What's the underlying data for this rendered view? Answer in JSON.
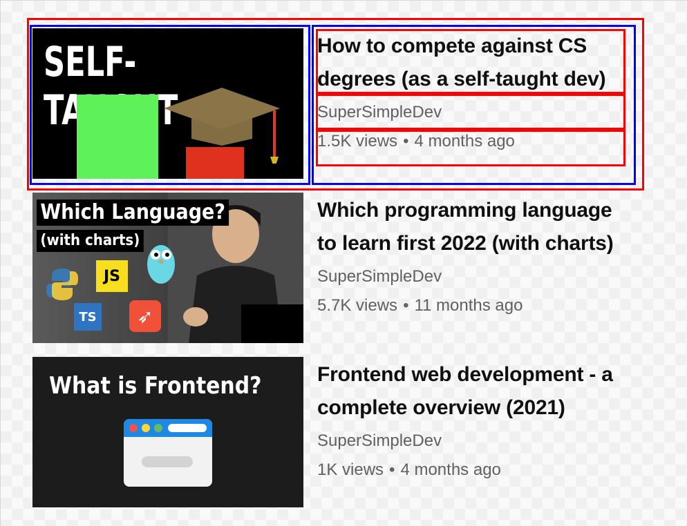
{
  "videos": [
    {
      "title": "How to compete against CS degrees (as a self-taught dev)",
      "channel": "SuperSimpleDev",
      "views": "1.5K views",
      "separator": "•",
      "age": "4 months ago",
      "thumbnail_text": "SELF-TAUGHT"
    },
    {
      "title": "Which programming language to learn first 2022 (with charts)",
      "channel": "SuperSimpleDev",
      "views": "5.7K views",
      "separator": "•",
      "age": "11 months ago",
      "thumbnail_text": "Which Language?",
      "thumbnail_subtext": "(with charts)",
      "thumbnail_logos": {
        "js": "JS",
        "ts": "TS"
      }
    },
    {
      "title": "Frontend web development - a complete overview (2021)",
      "channel": "SuperSimpleDev",
      "views": "1K views",
      "separator": "•",
      "age": "4 months ago",
      "thumbnail_text": "What is Frontend?"
    }
  ],
  "colors": {
    "annotation_red": "#ff0000",
    "annotation_blue": "#0000ff",
    "title_text": "#0f0f0f",
    "meta_text": "#606060"
  }
}
